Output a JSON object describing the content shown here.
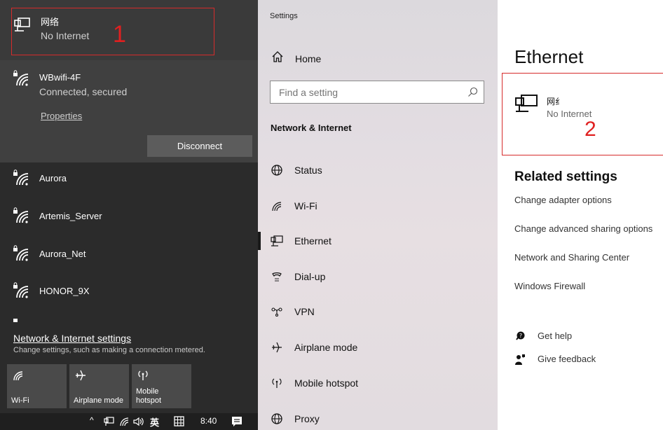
{
  "flyout": {
    "ethernet": {
      "name": "网络",
      "status": "No Internet",
      "annotation": "1"
    },
    "connected_wifi": {
      "name": "WBwifi-4F",
      "status": "Connected, secured",
      "properties_label": "Properties",
      "disconnect_label": "Disconnect"
    },
    "networks": [
      {
        "name": "Aurora"
      },
      {
        "name": "Artemis_Server"
      },
      {
        "name": "Aurora_Net"
      },
      {
        "name": "HONOR_9X"
      }
    ],
    "settings_link": "Network & Internet settings",
    "settings_desc": "Change settings, such as making a connection metered.",
    "tiles": [
      {
        "label": "Wi-Fi",
        "icon": "wifi-icon"
      },
      {
        "label": "Airplane mode",
        "icon": "airplane-icon"
      },
      {
        "label": "Mobile hotspot",
        "label_line1": "Mobile",
        "label_line2": "hotspot",
        "icon": "hotspot-icon"
      }
    ],
    "taskbar": {
      "ime": "英",
      "time": "8:40"
    }
  },
  "settings": {
    "title": "Settings",
    "home_label": "Home",
    "search_placeholder": "Find a setting",
    "section_title": "Network & Internet",
    "nav": [
      {
        "label": "Status",
        "icon": "globe-icon"
      },
      {
        "label": "Wi-Fi",
        "icon": "wifi-icon"
      },
      {
        "label": "Ethernet",
        "icon": "ethernet-icon",
        "selected": true
      },
      {
        "label": "Dial-up",
        "icon": "phone-icon"
      },
      {
        "label": "VPN",
        "icon": "vpn-icon"
      },
      {
        "label": "Airplane mode",
        "icon": "airplane-icon"
      },
      {
        "label": "Mobile hotspot",
        "icon": "hotspot-icon"
      },
      {
        "label": "Proxy",
        "icon": "globe-icon"
      }
    ]
  },
  "content": {
    "title": "Ethernet",
    "ethernet": {
      "name": "网纟",
      "status": "No Internet",
      "annotation": "2"
    },
    "related_title": "Related settings",
    "related_links": [
      "Change adapter options",
      "Change advanced sharing options",
      "Network and Sharing Center",
      "Windows Firewall"
    ],
    "get_help": "Get help",
    "give_feedback": "Give feedback"
  },
  "colors": {
    "flyout_bg": "#2b2b2b",
    "annotation_red": "#e02020",
    "selected_bar": "#1a1a1a"
  }
}
